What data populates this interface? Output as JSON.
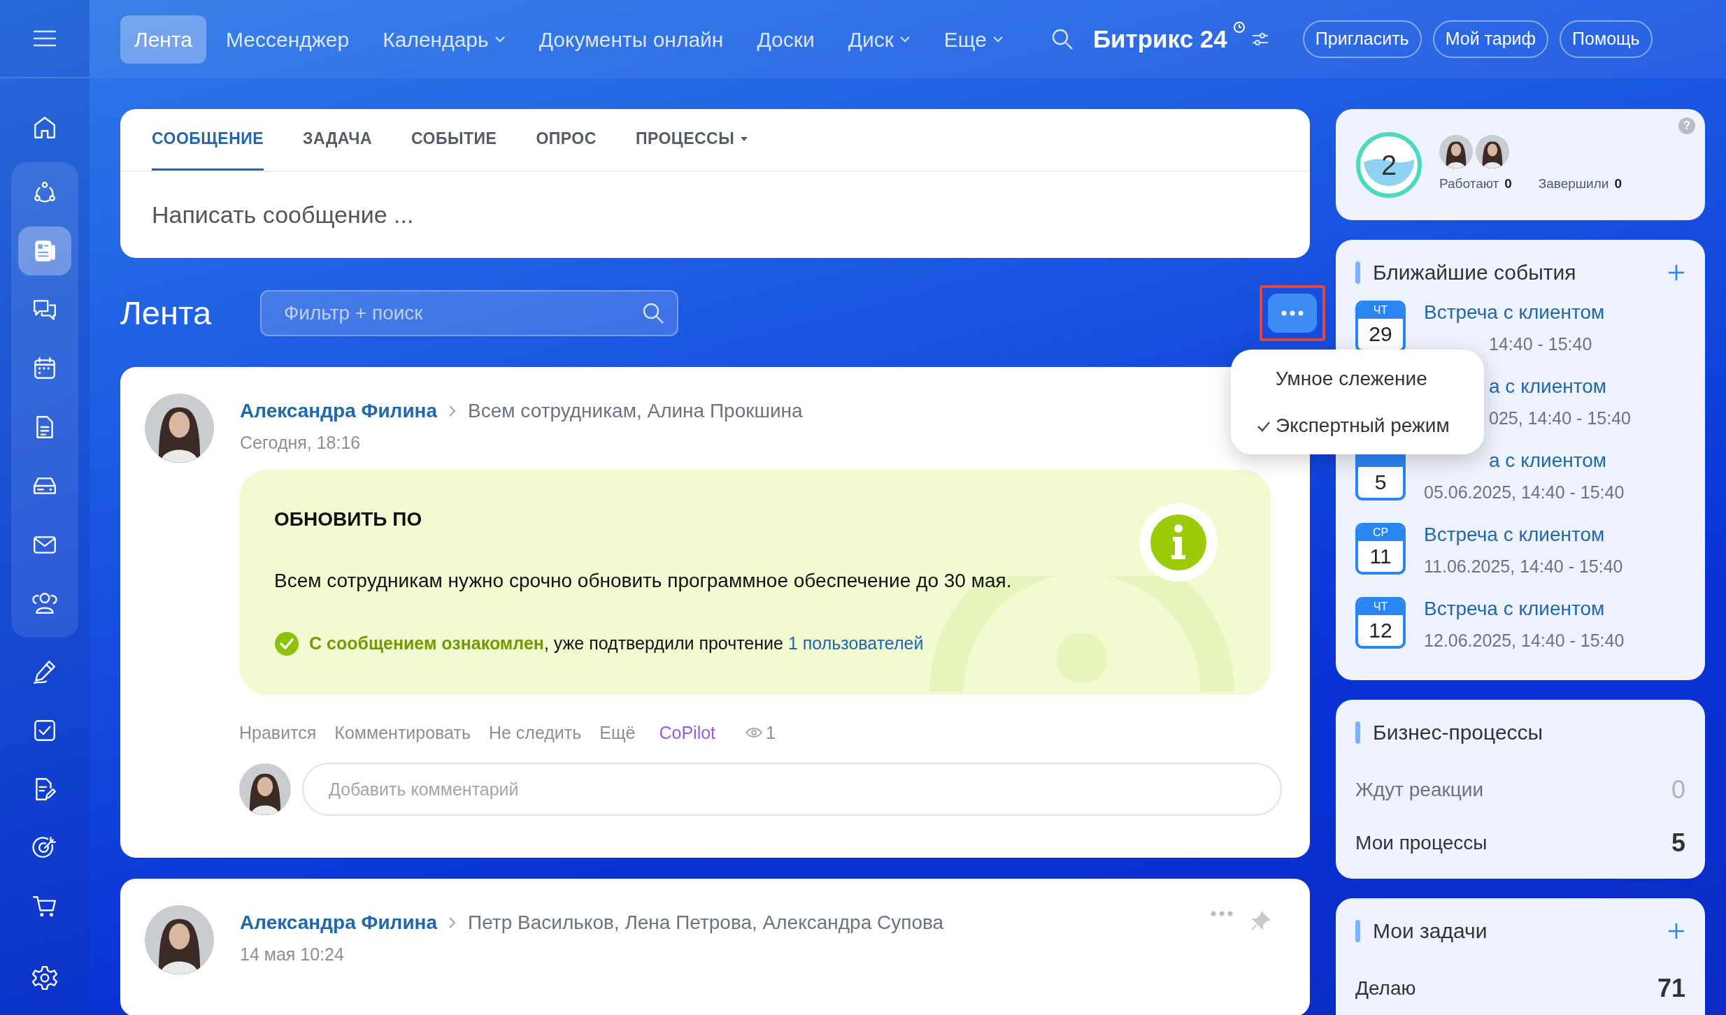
{
  "sidebar": {
    "items": [
      {
        "kind": "home",
        "selected": false,
        "group": false
      },
      {
        "kind": "share",
        "selected": false,
        "group": true
      },
      {
        "kind": "news",
        "selected": true,
        "group": true
      },
      {
        "kind": "chat",
        "selected": false,
        "group": true
      },
      {
        "kind": "calendar",
        "selected": false,
        "group": true
      },
      {
        "kind": "document",
        "selected": false,
        "group": true
      },
      {
        "kind": "drive",
        "selected": false,
        "group": true
      },
      {
        "kind": "mail",
        "selected": false,
        "group": true
      },
      {
        "kind": "people",
        "selected": false,
        "group": true
      },
      {
        "kind": "pen",
        "selected": false,
        "group": false
      },
      {
        "kind": "task",
        "selected": false,
        "group": false
      },
      {
        "kind": "edit",
        "selected": false,
        "group": false
      },
      {
        "kind": "target",
        "selected": false,
        "group": false
      },
      {
        "kind": "cart",
        "selected": false,
        "group": false
      },
      {
        "kind": "settings",
        "selected": false,
        "group": false
      }
    ]
  },
  "topbar": {
    "nav": [
      {
        "label": "Лента",
        "selected": true,
        "dropdown": false
      },
      {
        "label": "Мессенджер",
        "selected": false,
        "dropdown": false
      },
      {
        "label": "Календарь",
        "selected": false,
        "dropdown": true
      },
      {
        "label": "Документы онлайн",
        "selected": false,
        "dropdown": false
      },
      {
        "label": "Доски",
        "selected": false,
        "dropdown": false
      },
      {
        "label": "Диск",
        "selected": false,
        "dropdown": true
      },
      {
        "label": "Еще",
        "selected": false,
        "dropdown": true
      }
    ],
    "brand": "Битрикс",
    "brand_number": "24",
    "buttons": [
      "Пригласить",
      "Мой тариф",
      "Помощь"
    ]
  },
  "composer": {
    "tabs": [
      {
        "label": "СООБЩЕНИЕ",
        "selected": true,
        "dropdown": false
      },
      {
        "label": "ЗАДАЧА",
        "selected": false,
        "dropdown": false
      },
      {
        "label": "СОБЫТИЕ",
        "selected": false,
        "dropdown": false
      },
      {
        "label": "ОПРОС",
        "selected": false,
        "dropdown": false
      },
      {
        "label": "ПРОЦЕССЫ",
        "selected": false,
        "dropdown": true
      }
    ],
    "placeholder": "Написать сообщение ..."
  },
  "feed": {
    "title": "Лента",
    "filter_placeholder": "Фильтр + поиск",
    "menu": {
      "items": [
        {
          "label": "Умное слежение",
          "checked": false
        },
        {
          "label": "Экспертный режим",
          "checked": true
        }
      ]
    }
  },
  "posts": [
    {
      "author": "Александра Филина",
      "recipients": "Всем сотрудникам, Алина Прокшина",
      "time": "Сегодня, 18:16",
      "announcement": {
        "title": "ОБНОВИТЬ ПО",
        "text": "Всем сотрудникам нужно срочно обновить программное обеспечение до 30 мая.",
        "confirm": "**С сообщением ознакомлен**,  уже подтвердили прочтение",
        "link": "1 пользователей"
      },
      "actions": [
        {
          "label": "Нравится",
          "kind": "plain"
        },
        {
          "label": "Комментировать",
          "kind": "plain"
        },
        {
          "label": "Не следить",
          "kind": "plain"
        },
        {
          "label": "Ещё",
          "kind": "plain"
        },
        {
          "label": "CoPilot",
          "kind": "ai"
        }
      ],
      "views": "1",
      "comment_placeholder": "Добавить комментарий"
    },
    {
      "author": "Александра Филина",
      "recipients": "Петр Васильков, Лена Петрова, Александра Супова",
      "time": "14 мая 10:24"
    }
  ],
  "worktime": {
    "count": "2",
    "help": "?",
    "working_label": "Работают",
    "working": "0",
    "done_label": "Завершили",
    "done": "0"
  },
  "events": {
    "title": "Ближайшие события",
    "items": [
      {
        "kind": "date_cut",
        "weekday": "ЧТ",
        "day": "29",
        "title": "Встреча с клиентом",
        "date": "14:40 - 15:40"
      },
      {
        "kind": "covered",
        "title": "а с клиентом",
        "date": "025, 14:40 - 15:40"
      },
      {
        "kind": "title_cut",
        "day": "5",
        "title": "а с клиентом",
        "date": "05.06.2025, 14:40 - 15:40"
      },
      {
        "kind": "full",
        "weekday": "СР",
        "day": "11",
        "title": "Встреча с клиентом",
        "date": "11.06.2025, 14:40 - 15:40"
      },
      {
        "kind": "full",
        "weekday": "ЧТ",
        "day": "12",
        "title": "Встреча с клиентом",
        "date": "12.06.2025, 14:40 - 15:40"
      }
    ]
  },
  "processes": {
    "title": "Бизнес-процессы",
    "rows": [
      {
        "label": "Ждут реакции",
        "value": "0",
        "muted": true
      },
      {
        "label": "Мои процессы",
        "value": "5",
        "muted": false
      }
    ]
  },
  "tasks": {
    "title": "Мои задачи",
    "rows": [
      {
        "label": "Делаю",
        "value": "71",
        "muted": false
      }
    ]
  }
}
